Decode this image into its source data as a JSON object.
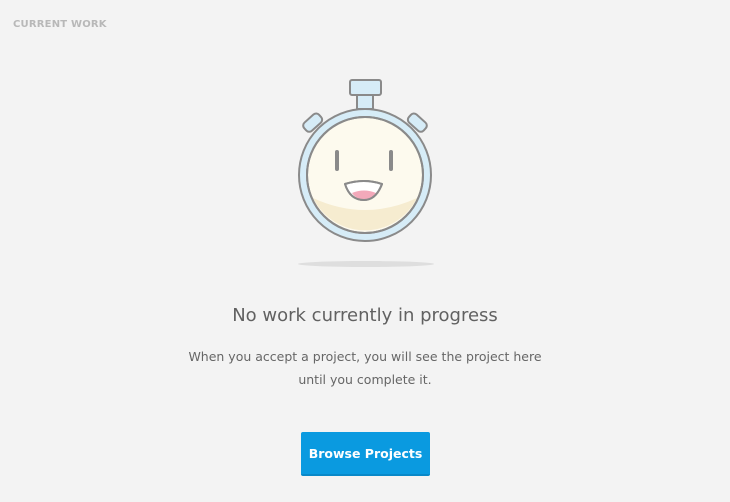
{
  "header": {
    "section_label": "CURRENT WORK"
  },
  "empty_state": {
    "illustration_icon": "stopwatch-smiley-icon",
    "title": "No work currently in progress",
    "description_line1": "When you accept a project, you will see the project here",
    "description_line2": "until you complete it.",
    "button_label": "Browse Projects"
  },
  "colors": {
    "background": "#f3f3f3",
    "accent": "#0a9ae0",
    "stopwatch_ring": "#d6ecf7",
    "stopwatch_face": "#fdfaee",
    "outline": "#8a8a8a"
  }
}
